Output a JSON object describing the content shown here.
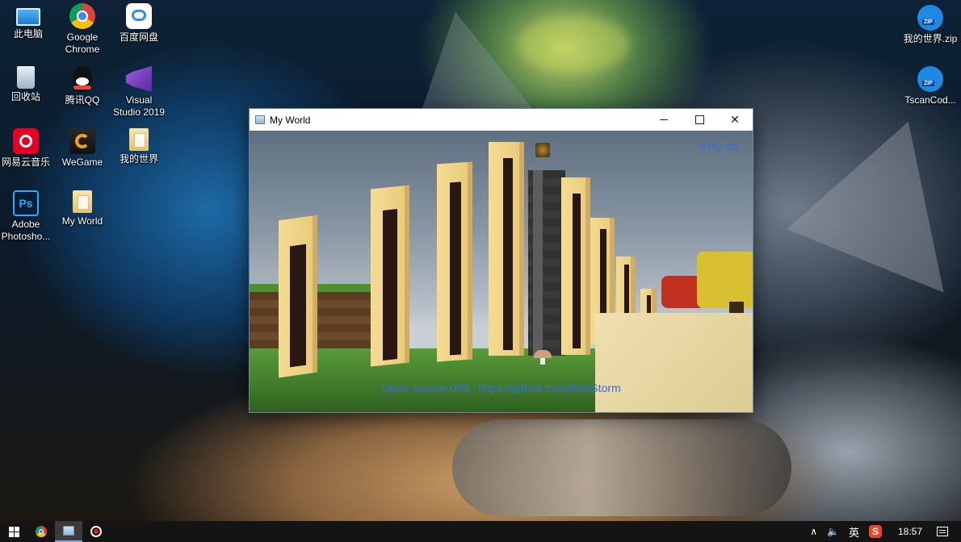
{
  "desktop": {
    "icons_left": [
      {
        "label": "此电脑",
        "icon": "computer-icon"
      },
      {
        "label": "Google\nChrome",
        "icon": "chrome-icon"
      },
      {
        "label": "百度网盘",
        "icon": "baidu-netdisk-icon"
      },
      {
        "label": "回收站",
        "icon": "recycle-bin-icon"
      },
      {
        "label": "腾讯QQ",
        "icon": "qq-icon"
      },
      {
        "label": "Visual\nStudio 2019",
        "icon": "visual-studio-icon"
      },
      {
        "label": "网易云音乐",
        "icon": "netease-music-icon"
      },
      {
        "label": "WeGame",
        "icon": "wegame-icon"
      },
      {
        "label": "我的世界",
        "icon": "folder-icon"
      },
      {
        "label": "Adobe\nPhotosho...",
        "icon": "photoshop-icon"
      },
      {
        "label": "My World",
        "icon": "folder-icon"
      }
    ],
    "icons_right": [
      {
        "label": "我的世界.zip",
        "icon": "zip-file-icon"
      },
      {
        "label": "TscanCod...",
        "icon": "zip-file-icon"
      }
    ]
  },
  "window": {
    "title": "My World",
    "controls": {
      "close": "✕"
    },
    "game": {
      "fps": "FPS:49",
      "url": "Open source URL: https://github.com/BueStorm"
    }
  },
  "taskbar": {
    "tray": {
      "caret": "∧",
      "volume": "🔈",
      "ime": "英",
      "sogou": "S",
      "time": "18:57"
    }
  },
  "colors": {
    "overlay_text": "#3a6bd8",
    "taskbar": "#141414"
  }
}
